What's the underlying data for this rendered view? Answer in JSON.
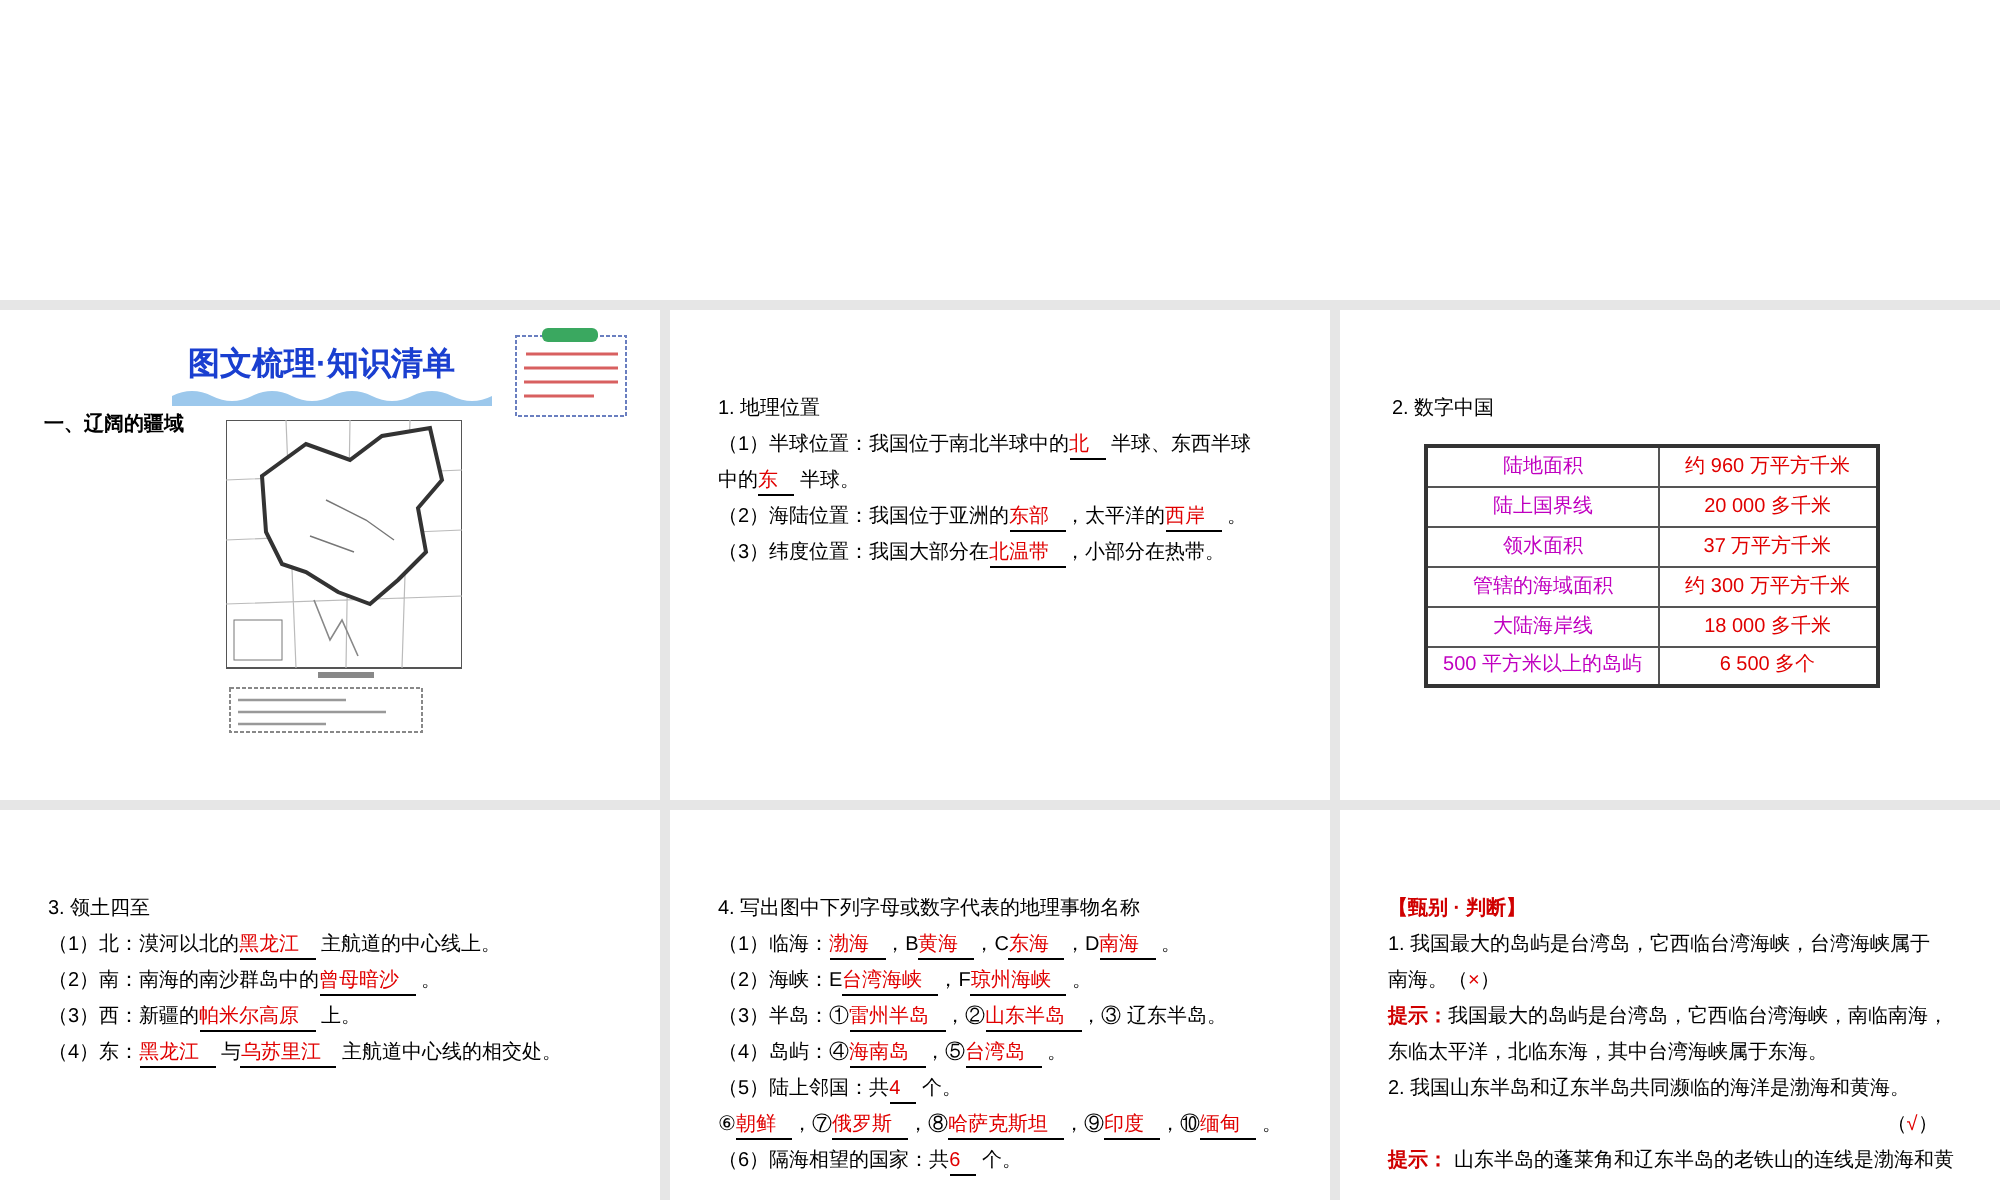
{
  "slides": [
    {
      "kind": "map",
      "title": "图文梳理·知识清单",
      "heading": "一、辽阔的疆域"
    },
    {
      "kind": "text",
      "lines": [
        {
          "segments": [
            {
              "kind": "text",
              "text": "1. 地理位置"
            }
          ]
        },
        {
          "segments": [
            {
              "kind": "text",
              "text": "（1）半球位置：我国位于南北半球中的"
            },
            {
              "kind": "blank",
              "text": "北"
            },
            {
              "kind": "text",
              "text": " 半球、东西半球"
            }
          ]
        },
        {
          "segments": [
            {
              "kind": "text",
              "text": "中的"
            },
            {
              "kind": "blank",
              "text": "东"
            },
            {
              "kind": "text",
              "text": " 半球。"
            }
          ]
        },
        {
          "segments": [
            {
              "kind": "text",
              "text": "（2）海陆位置：我国位于亚洲的"
            },
            {
              "kind": "blank",
              "text": "东部"
            },
            {
              "kind": "text",
              "text": "，太平洋的"
            },
            {
              "kind": "blank",
              "text": "西岸"
            },
            {
              "kind": "text",
              "text": " 。"
            }
          ]
        },
        {
          "segments": [
            {
              "kind": "text",
              "text": "（3）纬度位置：我国大部分在"
            },
            {
              "kind": "blank",
              "text": "北温带"
            },
            {
              "kind": "text",
              "text": "，小部分在热带。"
            }
          ]
        }
      ]
    },
    {
      "kind": "table",
      "heading": "2. 数字中国",
      "rows": [
        {
          "label": "陆地面积",
          "value": "约 960 万平方千米"
        },
        {
          "label": "陆上国界线",
          "value": "20  000 多千米"
        },
        {
          "label": "领水面积",
          "value": "37 万平方千米"
        },
        {
          "label": "管辖的海域面积",
          "value": "约 300 万平方千米"
        },
        {
          "label": "大陆海岸线",
          "value": "18  000 多千米"
        },
        {
          "label": "500 平方米以上的岛屿",
          "value": "6  500 多个"
        }
      ]
    },
    {
      "kind": "text",
      "lines": [
        {
          "segments": [
            {
              "kind": "text",
              "text": "3. 领土四至"
            }
          ]
        },
        {
          "segments": [
            {
              "kind": "text",
              "text": "（1）北：漠河以北的"
            },
            {
              "kind": "blank",
              "text": "黑龙江"
            },
            {
              "kind": "text",
              "text": " 主航道的中心线上。"
            }
          ]
        },
        {
          "segments": [
            {
              "kind": "text",
              "text": "（2）南：南海的南沙群岛中的"
            },
            {
              "kind": "blank",
              "text": "曾母暗沙"
            },
            {
              "kind": "text",
              "text": " 。"
            }
          ]
        },
        {
          "segments": [
            {
              "kind": "text",
              "text": "（3）西：新疆的"
            },
            {
              "kind": "blank",
              "text": "帕米尔高原"
            },
            {
              "kind": "text",
              "text": " 上。"
            }
          ]
        },
        {
          "segments": [
            {
              "kind": "text",
              "text": "（4）东："
            },
            {
              "kind": "blank",
              "text": "黑龙江"
            },
            {
              "kind": "text",
              "text": " 与"
            },
            {
              "kind": "blank",
              "text": "乌苏里江"
            },
            {
              "kind": "text",
              "text": " 主航道中心线的相交处。"
            }
          ]
        }
      ]
    },
    {
      "kind": "text",
      "lines": [
        {
          "segments": [
            {
              "kind": "text",
              "text": "4. 写出图中下列字母或数字代表的地理事物名称"
            }
          ]
        },
        {
          "segments": [
            {
              "kind": "text",
              "text": "（1）临海："
            },
            {
              "kind": "blank",
              "text": "渤海"
            },
            {
              "kind": "text",
              "text": "，B"
            },
            {
              "kind": "blank",
              "text": "黄海"
            },
            {
              "kind": "text",
              "text": "，C"
            },
            {
              "kind": "blank",
              "text": "东海"
            },
            {
              "kind": "text",
              "text": "，D"
            },
            {
              "kind": "blank",
              "text": "南海"
            },
            {
              "kind": "text",
              "text": " 。"
            }
          ]
        },
        {
          "segments": [
            {
              "kind": "text",
              "text": "（2）海峡：E"
            },
            {
              "kind": "blank",
              "text": "台湾海峡"
            },
            {
              "kind": "text",
              "text": "，F"
            },
            {
              "kind": "blank",
              "text": "琼州海峡"
            },
            {
              "kind": "text",
              "text": " 。"
            }
          ]
        },
        {
          "segments": [
            {
              "kind": "text",
              "text": "（3）半岛：①"
            },
            {
              "kind": "blank",
              "text": "雷州半岛"
            },
            {
              "kind": "text",
              "text": "，②"
            },
            {
              "kind": "blank",
              "text": "山东半岛"
            },
            {
              "kind": "text",
              "text": "，③ 辽东半岛。"
            }
          ]
        },
        {
          "segments": [
            {
              "kind": "text",
              "text": "（4）岛屿：④"
            },
            {
              "kind": "blank",
              "text": "海南岛"
            },
            {
              "kind": "text",
              "text": "，⑤"
            },
            {
              "kind": "blank",
              "text": "台湾岛"
            },
            {
              "kind": "text",
              "text": " 。"
            }
          ]
        },
        {
          "segments": [
            {
              "kind": "text",
              "text": "（5）陆上邻国：共"
            },
            {
              "kind": "blank",
              "text": "4"
            },
            {
              "kind": "text",
              "text": " 个。"
            }
          ]
        },
        {
          "segments": [
            {
              "kind": "text",
              "text": "⑥"
            },
            {
              "kind": "blank",
              "text": "朝鲜"
            },
            {
              "kind": "text",
              "text": "，⑦"
            },
            {
              "kind": "blank",
              "text": "俄罗斯"
            },
            {
              "kind": "text",
              "text": "，⑧"
            },
            {
              "kind": "blank",
              "text": "哈萨克斯坦"
            },
            {
              "kind": "text",
              "text": "，⑨"
            },
            {
              "kind": "blank",
              "text": "印度"
            },
            {
              "kind": "text",
              "text": "，⑩"
            },
            {
              "kind": "blank",
              "text": "缅甸"
            },
            {
              "kind": "text",
              "text": " 。"
            }
          ]
        },
        {
          "segments": [
            {
              "kind": "text",
              "text": "（6）隔海相望的国家：共"
            },
            {
              "kind": "blank",
              "text": "6"
            },
            {
              "kind": "text",
              "text": " 个。"
            }
          ]
        }
      ]
    },
    {
      "kind": "text",
      "lines": [
        {
          "segments": [
            {
              "kind": "label",
              "text": "【甄别 · 判断】"
            }
          ]
        },
        {
          "segments": [
            {
              "kind": "text",
              "text": "1. 我国最大的岛屿是台湾岛，它西临台湾海峡，台湾海峡属于"
            }
          ]
        },
        {
          "segments": [
            {
              "kind": "text",
              "text": "南海。（"
            },
            {
              "kind": "mark",
              "text": "×"
            },
            {
              "kind": "text",
              "text": "）"
            }
          ]
        },
        {
          "segments": [
            {
              "kind": "label",
              "text": "提示："
            },
            {
              "kind": "text",
              "text": "我国最大的岛屿是台湾岛，它西临台湾海峡，南临南海，"
            }
          ]
        },
        {
          "segments": [
            {
              "kind": "text",
              "text": "东临太平洋，北临东海，其中台湾海峡属于东海。"
            }
          ]
        },
        {
          "segments": [
            {
              "kind": "text",
              "text": "2. 我国山东半岛和辽东半岛共同濒临的海洋是渤海和黄海。"
            }
          ]
        },
        {
          "kind": "answer_right",
          "segments": [
            {
              "kind": "text",
              "text": "（"
            },
            {
              "kind": "mark",
              "text": "√"
            },
            {
              "kind": "text",
              "text": "）"
            }
          ]
        },
        {
          "segments": [
            {
              "kind": "label",
              "text": "提示："
            },
            {
              "kind": "text",
              "text": " 山东半岛的蓬莱角和辽东半岛的老铁山的连线是渤海和黄"
            }
          ]
        }
      ]
    }
  ]
}
